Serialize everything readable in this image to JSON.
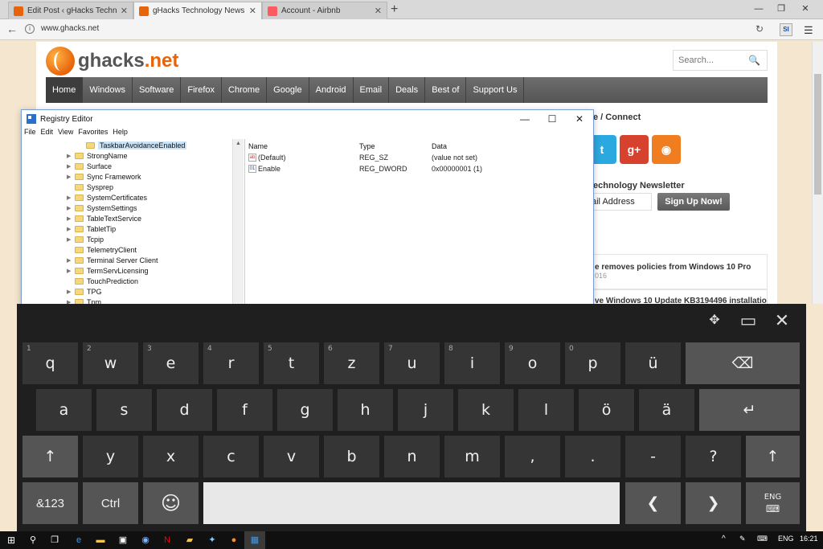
{
  "browser": {
    "tabs": [
      {
        "label": "Edit Post ‹ gHacks Techno…",
        "fav_color": "#e8640a"
      },
      {
        "label": "gHacks Technology News",
        "fav_color": "#e8640a"
      },
      {
        "label": "Account - Airbnb",
        "fav_color": "#ff5a5f"
      }
    ],
    "new_tab": "+",
    "win_min": "—",
    "win_restore": "❐",
    "win_close": "✕",
    "url": "www.ghacks.net",
    "ext_label": "SI"
  },
  "site": {
    "logo_brand": "ghacks",
    "logo_tld": ".net",
    "search_placeholder": "Search...",
    "nav": [
      "Home",
      "Windows",
      "Software",
      "Firefox",
      "Chrome",
      "Google",
      "Android",
      "Email",
      "Deals",
      "Best of",
      "Support Us"
    ],
    "connect_title": "e / Connect",
    "newsletter_title": "echnology Newsletter",
    "email_placeholder": "ail Address",
    "signup_label": "Sign Up Now!",
    "articles": [
      {
        "title": "e removes policies from Windows 10 Pro",
        "date": "016"
      },
      {
        "title": "ve Windows 10 Update KB3194496 installation",
        "date": ""
      }
    ]
  },
  "regedit": {
    "title": "Registry Editor",
    "menu": [
      "File",
      "Edit",
      "View",
      "Favorites",
      "Help"
    ],
    "tree": [
      {
        "label": "TaskbarAvoidanceEnabled",
        "selected": true,
        "arrow": false
      },
      {
        "label": "StrongName",
        "arrow": true
      },
      {
        "label": "Surface",
        "arrow": true
      },
      {
        "label": "Sync Framework",
        "arrow": true
      },
      {
        "label": "Sysprep",
        "arrow": false
      },
      {
        "label": "SystemCertificates",
        "arrow": true
      },
      {
        "label": "SystemSettings",
        "arrow": true
      },
      {
        "label": "TableTextService",
        "arrow": true
      },
      {
        "label": "TabletTip",
        "arrow": true
      },
      {
        "label": "Tcpip",
        "arrow": true
      },
      {
        "label": "TelemetryClient",
        "arrow": false
      },
      {
        "label": "Terminal Server Client",
        "arrow": true
      },
      {
        "label": "TermServLicensing",
        "arrow": true
      },
      {
        "label": "TouchPrediction",
        "arrow": false
      },
      {
        "label": "TPG",
        "arrow": true
      },
      {
        "label": "Tpm",
        "arrow": true
      }
    ],
    "columns": {
      "name": "Name",
      "type": "Type",
      "data": "Data"
    },
    "values": [
      {
        "name": "(Default)",
        "type": "REG_SZ",
        "data": "(value not set)",
        "icon": "ab"
      },
      {
        "name": "Enable",
        "type": "REG_DWORD",
        "data": "0x00000001 (1)",
        "icon": "01"
      }
    ]
  },
  "keyboard": {
    "row1": [
      {
        "k": "q",
        "n": "1"
      },
      {
        "k": "w",
        "n": "2"
      },
      {
        "k": "e",
        "n": "3"
      },
      {
        "k": "r",
        "n": "4"
      },
      {
        "k": "t",
        "n": "5"
      },
      {
        "k": "z",
        "n": "6"
      },
      {
        "k": "u",
        "n": "7"
      },
      {
        "k": "i",
        "n": "8"
      },
      {
        "k": "o",
        "n": "9"
      },
      {
        "k": "p",
        "n": "0"
      },
      {
        "k": "ü",
        "n": ""
      }
    ],
    "row2": [
      "a",
      "s",
      "d",
      "f",
      "g",
      "h",
      "j",
      "k",
      "l",
      "ö",
      "ä"
    ],
    "row3": [
      "y",
      "x",
      "c",
      "v",
      "b",
      "n",
      "m",
      ",",
      ".",
      "-",
      "?"
    ],
    "backspace": "⌫",
    "enter": "↵",
    "shift": "↑",
    "symbols": "&123",
    "ctrl": "Ctrl",
    "emoji": "☺",
    "left": "❮",
    "right": "❯",
    "lang": "ENG",
    "lang_glyph": "⌨",
    "top_move": "✥",
    "top_layout": "▭",
    "top_close": "✕"
  },
  "taskbar": {
    "lang": "ENG",
    "time": "16:21"
  }
}
